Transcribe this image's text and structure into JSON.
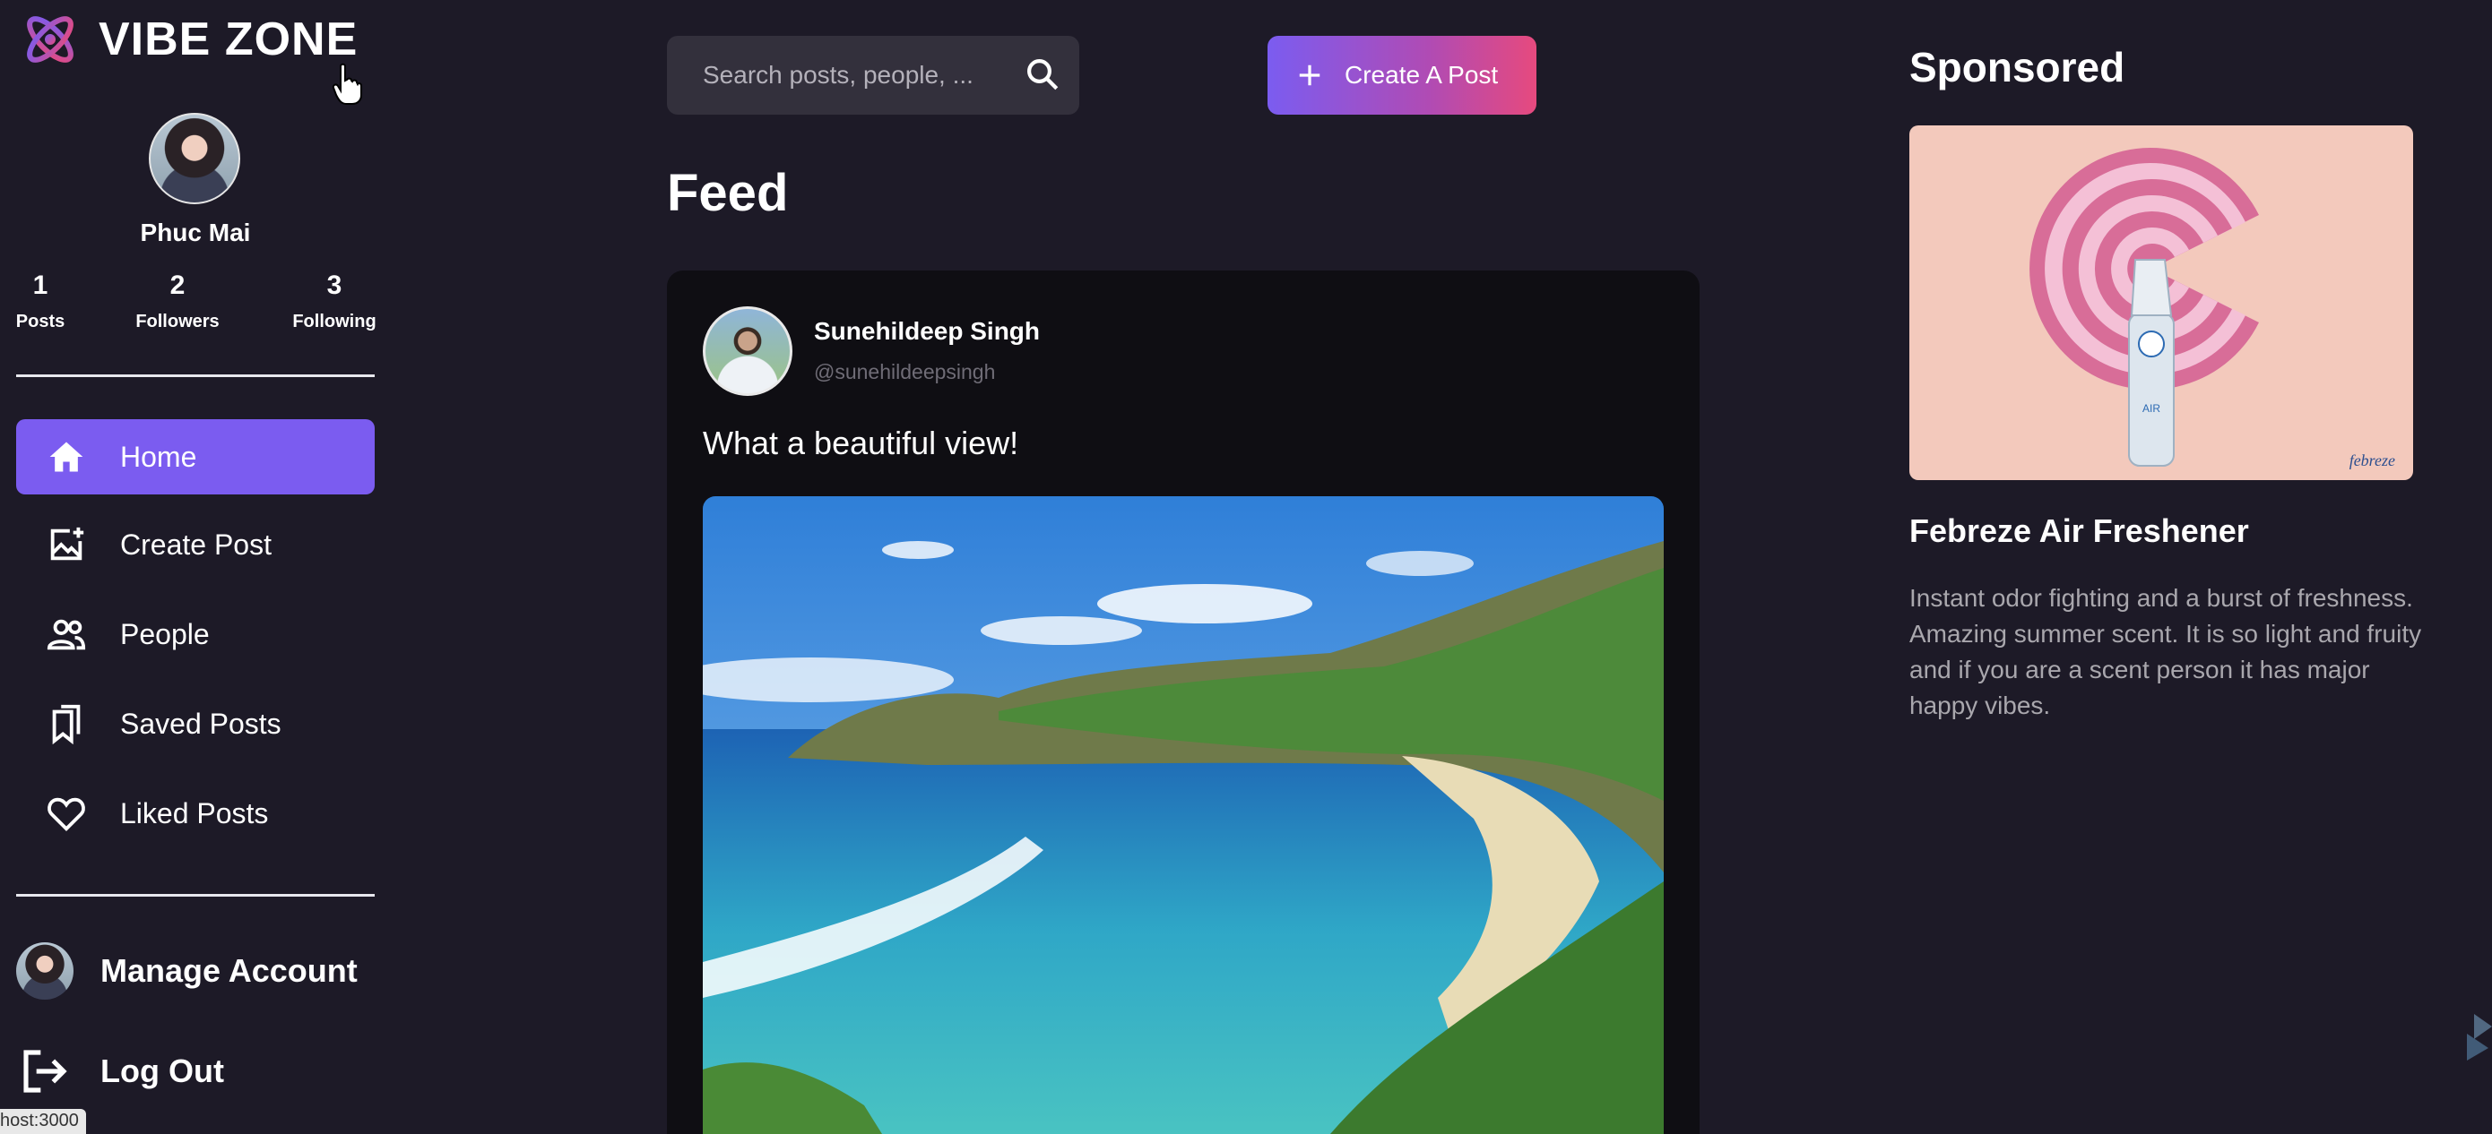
{
  "app": {
    "name": "VIBE ZONE"
  },
  "profile": {
    "name": "Phuc Mai",
    "stats": [
      {
        "value": "1",
        "label": "Posts"
      },
      {
        "value": "2",
        "label": "Followers"
      },
      {
        "value": "3",
        "label": "Following"
      }
    ]
  },
  "nav": {
    "items": [
      {
        "label": "Home",
        "icon": "home-icon",
        "active": true
      },
      {
        "label": "Create Post",
        "icon": "add-image-icon",
        "active": false
      },
      {
        "label": "People",
        "icon": "people-icon",
        "active": false
      },
      {
        "label": "Saved Posts",
        "icon": "bookmark-icon",
        "active": false
      },
      {
        "label": "Liked Posts",
        "icon": "heart-icon",
        "active": false
      }
    ]
  },
  "account": {
    "manage_label": "Manage Account",
    "logout_label": "Log Out"
  },
  "status_url": "host:3000",
  "search": {
    "placeholder": "Search posts, people, ..."
  },
  "create_button": {
    "label": "Create A Post"
  },
  "feed": {
    "title": "Feed",
    "post": {
      "author_name": "Sunehildeep Singh",
      "author_handle": "@sunehildeepsingh",
      "text": "What a beautiful view!"
    }
  },
  "sponsored": {
    "title": "Sponsored",
    "ad_name": "Febreze Air Freshener",
    "ad_description": "Instant odor fighting and a burst of freshness. Amazing summer scent. It is so light and fruity and if you are a scent person it has major happy vibes.",
    "ad_brand": "febreze",
    "ad_product_label": "AIR"
  },
  "colors": {
    "background": "#1d1a27",
    "accent": "#7b5cf0",
    "gradient_end": "#e64a7e",
    "card": "#0f0e13"
  }
}
